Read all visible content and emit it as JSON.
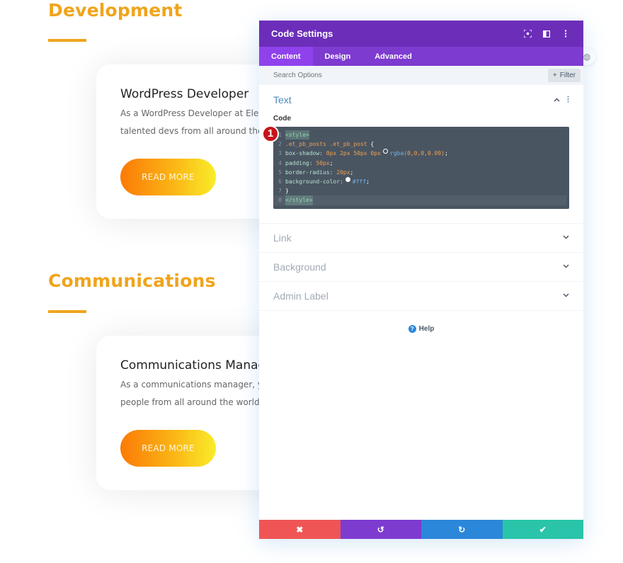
{
  "background": {
    "sections": [
      {
        "heading": "Development",
        "card": {
          "title": "WordPress Developer",
          "text_line1": "As a WordPress Developer at Elega",
          "text_line2": "talented devs from all around the w",
          "button": "READ MORE"
        }
      },
      {
        "heading": "Communications",
        "card": {
          "title": "Communications Manag",
          "text_line1": "As a communications manager, you",
          "text_line2": "people from all around the world. W",
          "button": "READ MORE"
        }
      }
    ],
    "accent_color": "#f0a41c"
  },
  "modal": {
    "title": "Code Settings",
    "header_icons": [
      "fullscreen-icon",
      "split-view-icon",
      "more-options-icon"
    ],
    "tabs": [
      {
        "label": "Content",
        "active": true
      },
      {
        "label": "Design",
        "active": false
      },
      {
        "label": "Advanced",
        "active": false
      }
    ],
    "search": {
      "placeholder": "Search Options",
      "value": ""
    },
    "filter_label": "Filter",
    "open_group": {
      "title": "Text",
      "field_label": "Code",
      "badge": "1",
      "code_lines": [
        "<style>",
        ".et_pb_posts .et_pb_post {",
        "box-shadow: 0px 2px 50px 0px rgba(0,0,0,0.09);",
        "padding: 50px;",
        "border-radius: 20px;",
        "background-color: #fff;",
        "}",
        "</style>"
      ],
      "code_tokens": {
        "l1": "<style>",
        "l2_sel": ".et_pb_posts .et_pb_post",
        "l2_brace": " {",
        "l3_prop": "box-shadow:",
        "l3_vals": " 0px 2px 50px 0px",
        "l3_fn": "rgba",
        "l3_args": "(0,0,0,0.09)",
        "l3_end": ";",
        "l4_prop": "padding:",
        "l4_val": " 50px",
        "l4_end": ";",
        "l5_prop": "border-radius:",
        "l5_val": " 20px",
        "l5_end": ";",
        "l6_prop": "background-color:",
        "l6_val": "#fff",
        "l6_end": ";",
        "l7": "}",
        "l8": "</style>"
      }
    },
    "groups": [
      {
        "title": "Link"
      },
      {
        "title": "Background"
      },
      {
        "title": "Admin Label"
      }
    ],
    "help_label": "Help",
    "footer": {
      "cancel": "✖",
      "undo": "↺",
      "redo": "↻",
      "save": "✔"
    },
    "colors": {
      "header": "#6c2eb9",
      "tabs": "#7d3bcf",
      "cancel": "#ef5555",
      "undo": "#7e3bd0",
      "redo": "#2b87da",
      "save": "#29c4a9"
    }
  }
}
